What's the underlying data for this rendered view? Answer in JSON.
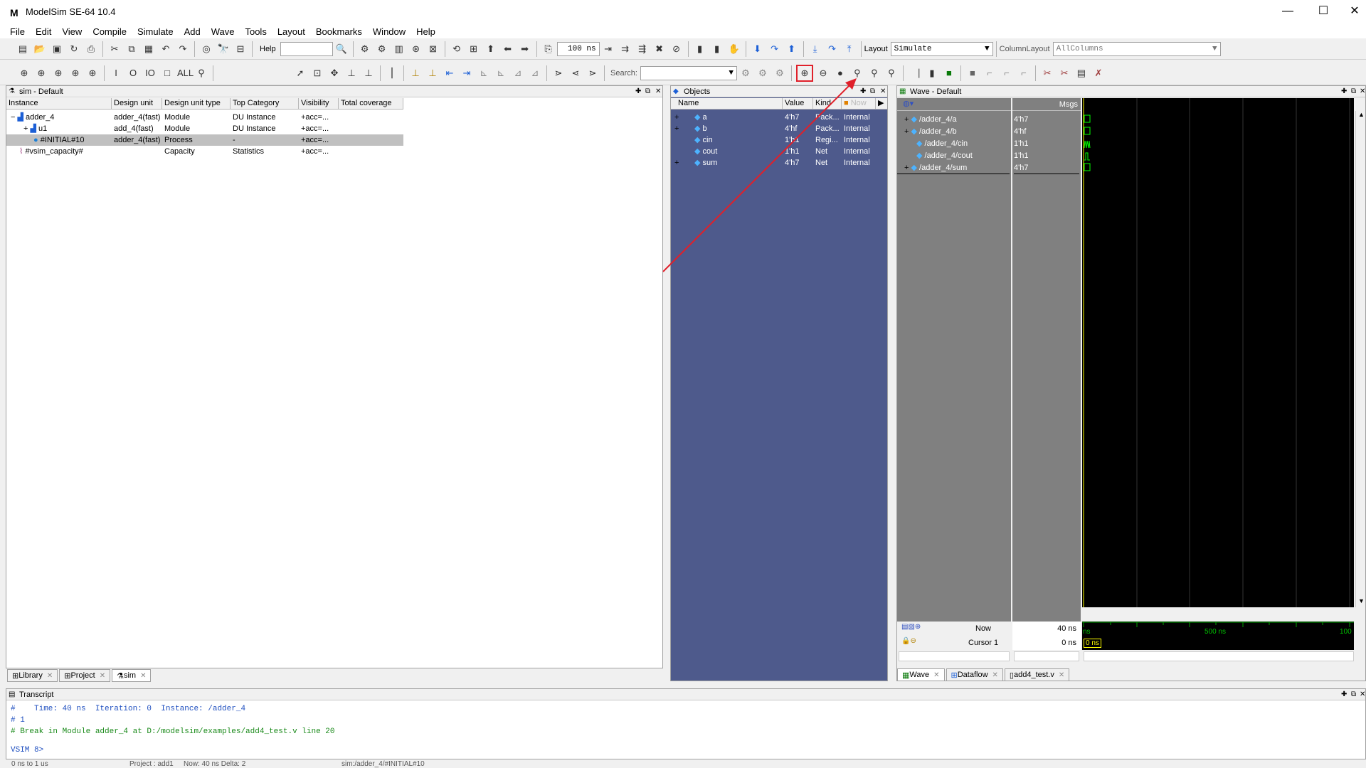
{
  "window": {
    "title": "ModelSim SE-64 10.4",
    "logo": "M",
    "minimize": "—",
    "maximize": "☐",
    "close": "✕"
  },
  "menu": [
    "File",
    "Edit",
    "View",
    "Compile",
    "Simulate",
    "Add",
    "Wave",
    "Tools",
    "Layout",
    "Bookmarks",
    "Window",
    "Help"
  ],
  "toolbar": {
    "help_label": "Help",
    "run_length": "100 ns",
    "layout_label": "Layout",
    "layout_value": "Simulate",
    "column_layout_label": "ColumnLayout",
    "column_layout_value": "AllColumns",
    "search_label": "Search:"
  },
  "sim_pane": {
    "title": "sim - Default",
    "columns": [
      "Instance",
      "Design unit",
      "Design unit type",
      "Top Category",
      "Visibility",
      "Total coverage"
    ],
    "rows": [
      {
        "expand": "−",
        "name": "adder_4",
        "unit": "adder_4(fast)",
        "type": "Module",
        "category": "DU Instance",
        "visibility": "+acc=..."
      },
      {
        "expand": "+",
        "name": "u1",
        "unit": "add_4(fast)",
        "type": "Module",
        "category": "DU Instance",
        "visibility": "+acc=..."
      },
      {
        "expand": "",
        "name": "#INITIAL#10",
        "unit": "adder_4(fast)",
        "type": "Process",
        "category": "-",
        "visibility": "+acc=..."
      },
      {
        "expand": "",
        "name": "#vsim_capacity#",
        "unit": "",
        "type": "Capacity",
        "category": "Statistics",
        "visibility": "+acc=..."
      }
    ],
    "tabs": [
      "Library",
      "Project",
      "sim"
    ]
  },
  "objects_pane": {
    "title": "Objects",
    "columns": [
      "Name",
      "Value",
      "Kind",
      "Now"
    ],
    "rows": [
      {
        "expand": "+",
        "name": "a",
        "value": "4'h7",
        "kind": "Pack...",
        "mode": "Internal"
      },
      {
        "expand": "+",
        "name": "b",
        "value": "4'hf",
        "kind": "Pack...",
        "mode": "Internal"
      },
      {
        "expand": "",
        "name": "cin",
        "value": "1'h1",
        "kind": "Regi...",
        "mode": "Internal"
      },
      {
        "expand": "",
        "name": "cout",
        "value": "1'h1",
        "kind": "Net",
        "mode": "Internal"
      },
      {
        "expand": "+",
        "name": "sum",
        "value": "4'h7",
        "kind": "Net",
        "mode": "Internal"
      }
    ]
  },
  "wave_pane": {
    "title": "Wave - Default",
    "msgs_label": "Msgs",
    "signals": [
      {
        "expand": "+",
        "name": "/adder_4/a",
        "value": "4'h7"
      },
      {
        "expand": "+",
        "name": "/adder_4/b",
        "value": "4'hf"
      },
      {
        "expand": "",
        "name": "/adder_4/cin",
        "value": "1'h1"
      },
      {
        "expand": "",
        "name": "/adder_4/cout",
        "value": "1'h1"
      },
      {
        "expand": "+",
        "name": "/adder_4/sum",
        "value": "4'h7"
      }
    ],
    "now_label": "Now",
    "now_value": "40 ns",
    "cursor_label": "Cursor 1",
    "cursor_value": "0 ns",
    "cursor_tag": "0 ns",
    "ruler": {
      "left": "ns",
      "mid": "500 ns",
      "right": "100"
    },
    "tabs": [
      "Wave",
      "Dataflow",
      "add4_test.v"
    ]
  },
  "transcript": {
    "title": "Transcript",
    "lines": [
      "#    Time: 40 ns  Iteration: 0  Instance: /adder_4",
      "# 1",
      "# Break in Module adder_4 at D:/modelsim/examples/add4_test.v line 20"
    ],
    "prompt": "VSIM 8>"
  },
  "statusbar": {
    "left": "0 ns to 1 us",
    "project": "Project : add1",
    "now": "Now: 40 ns  Delta: 2",
    "path": "sim:/adder_4/#INITIAL#10"
  },
  "colors": {
    "objects_bg": "#4e5a8c",
    "wave_bg": "#000000",
    "wave_names_bg": "#808080",
    "highlight": "#c0c0c0",
    "annotation": "#e0202a",
    "wave_green": "#00ff00",
    "cursor_yellow": "#ffff00"
  }
}
